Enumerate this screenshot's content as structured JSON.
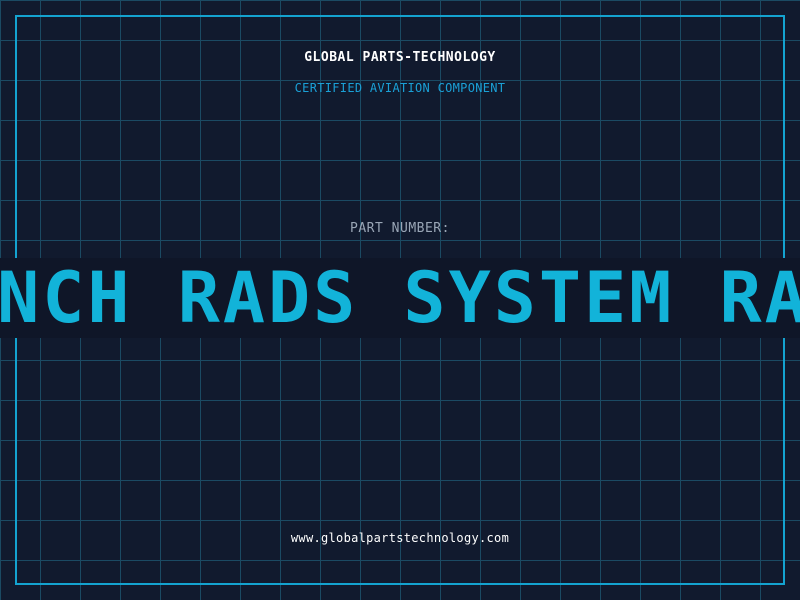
{
  "header": {
    "company": "GLOBAL PARTS-TECHNOLOGY",
    "tagline": "CERTIFIED AVIATION COMPONENT"
  },
  "part": {
    "label": "PART NUMBER:",
    "scrolling_text": "UNCH RADS SYSTEM RA"
  },
  "footer": {
    "url": "www.globalpartstechnology.com"
  },
  "colors": {
    "background": "#111a2e",
    "grid": "#1b4a63",
    "accent": "#14a3d0",
    "ticker_text": "#12b3d9",
    "ticker_band": "#0f1628"
  }
}
